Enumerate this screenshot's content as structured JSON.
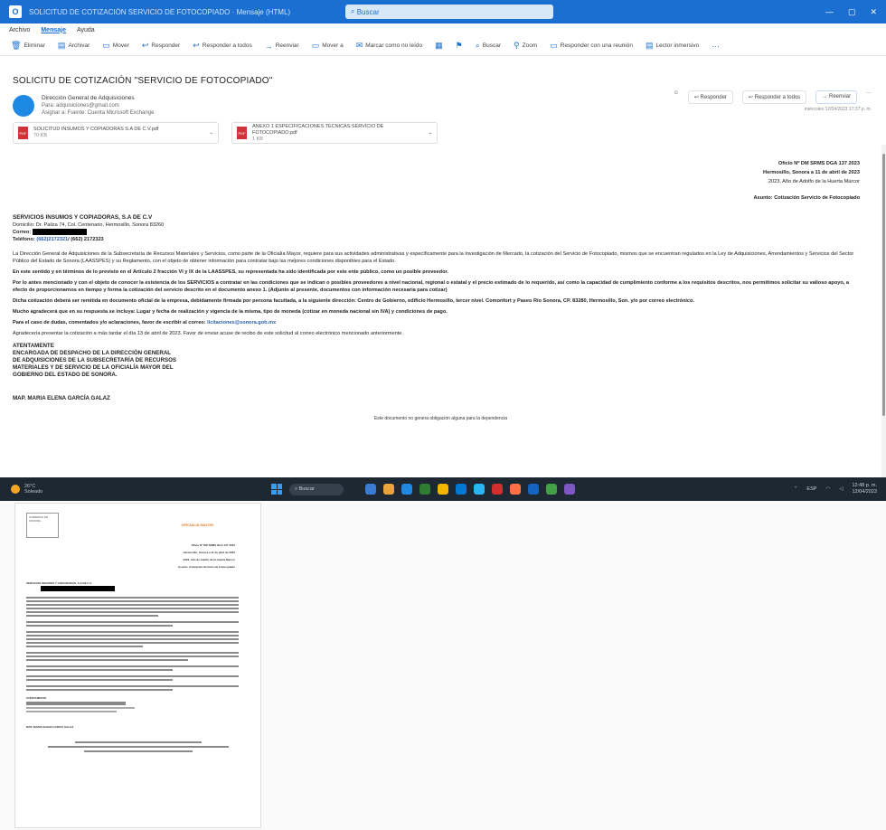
{
  "window": {
    "title": "SOLICITUD DE COTIZACIÓN SERVICIO DE FOTOCOPIADO · Mensaje (HTML)",
    "search_placeholder": "Buscar",
    "controls": [
      "—",
      "▢",
      "✕"
    ]
  },
  "menu_tabs": [
    "Archivo",
    "Mensaje",
    "Ayuda"
  ],
  "ribbon": [
    {
      "icon": "delete-icon",
      "glyph": "🗑",
      "label": "Eliminar"
    },
    {
      "icon": "archive-icon",
      "glyph": "▤",
      "label": "Archivar"
    },
    {
      "icon": "move-icon",
      "glyph": "▭",
      "label": "Mover"
    },
    {
      "icon": "reply-icon",
      "glyph": "↩",
      "label": "Responder"
    },
    {
      "icon": "reply-all-icon",
      "glyph": "↩",
      "label": "Responder a todos"
    },
    {
      "icon": "forward-icon",
      "glyph": "→",
      "label": "Reenviar"
    },
    {
      "icon": "quick-steps-icon",
      "glyph": "▭",
      "label": "Mover a"
    },
    {
      "icon": "mark-read-icon",
      "glyph": "✉",
      "label": "Marcar como no leído"
    },
    {
      "icon": "categorize-icon",
      "glyph": "▦",
      "label": ""
    },
    {
      "icon": "flag-icon",
      "glyph": "⚑",
      "label": ""
    },
    {
      "icon": "find-icon",
      "glyph": "⌕",
      "label": "Buscar"
    },
    {
      "icon": "zoom-icon",
      "glyph": "⚲",
      "label": "Zoom"
    },
    {
      "icon": "reply-all-meeting-icon",
      "glyph": "▭",
      "label": "Responder con una reunión"
    },
    {
      "icon": "immersive-reader-icon",
      "glyph": "▤",
      "label": "Lector inmersivo"
    },
    {
      "icon": "more-icon",
      "glyph": "···",
      "label": ""
    }
  ],
  "message": {
    "subject": "SOLICITU DE COTIZACIÓN \"SERVICIO DE FOTOCOPIADO\"",
    "sender_name": "Dirección General de Adquisiciones",
    "sender_email": "Para: adquisiciones@gmail.com",
    "sender_extra": "Asignar a: Fuente: Cuenta Microsoft Exchange",
    "actions": [
      "Responder",
      "Responder a todos",
      "Reenviar"
    ],
    "date": "miércoles 12/04/2023 17:37 p. m.",
    "attachments": [
      {
        "name": "SOLICITUD INSUMOS Y COPIADORAS S.A DE C.V.pdf",
        "size": "70 KB"
      },
      {
        "name": "ANEXO 1 ESPECIFICACIONES TECNICAS SERVICIO DE FOTOCOPIADO.pdf",
        "size": "1 KB"
      }
    ]
  },
  "letter": {
    "oficio": "Oficio Nº DM SRMS DGA 137 2023",
    "place_date": "Hermosillo, Sonora a 11 de abril de 2023",
    "year_motto": "2023, Año de Adolfo de la Huerta Marcor",
    "asunto": "Asunto: Cotización Servicio de Fotocopiado",
    "firm": "SERVICIOS INSUMOS Y COPIADORAS, S.A DE C.V",
    "address": "Domicilio: Dr. Paliza 74, Col. Centenario, Hermosillo, Sonora 83260",
    "email_label": "Correo:",
    "phone_label": "Teléfono:",
    "phone_value": "(662) 2172323",
    "paragraphs": [
      {
        "text": "La Dirección General de Adquisiciones de la Subsecretaría de Recursos Materiales y Servicios, como parte de la Oficialía Mayor, requiere para sus actividades administrativas y específicamente para la Investigación de Mercado, la cotización del Servicio de Fotocopiado, mismos que se encuentran regulados en la Ley de Adquisiciones, Arrendamientos y Servicios del Sector Público del Estado de Sonora (LAASSPES) y su Reglamento, con el objeto de obtener información para contratar bajo las mejores condiciones disponibles para el Estado.",
        "bold": false
      },
      {
        "text": "En este sentido y en términos de lo previsto en el Artículo 2 fracción VI y IX de la LAASSPES, su representada ha sido identificada por este ente público, como un posible proveedor.",
        "bold": true
      },
      {
        "text": "Por lo antes mencionado y con el objeto de conocer la existencia de los SERVICIOS a contratar en las condiciones que se indican o posibles proveedores a nivel nacional, regional o estatal y el precio estimado de lo requerido, así como la capacidad de cumplimiento conforme a los requisitos descritos, nos permitimos solicitar su valioso apoyo, a efecto de proporcionarnos en tiempo y forma la cotización del servicio descrito en el documento anexo 1. (Adjunto al presente, documentos con información necesaria para cotizar)",
        "bold": true
      },
      {
        "text": "Dicha cotización deberá ser remitida en documento oficial de la empresa, debidamente firmada por persona facultada, a la siguiente dirección: Centro de Gobierno, edificio Hermosillo, tercer nivel. Comonfort y Paseo Río Sonora, CP. 83280, Hermosillo, Son. y/o por correo electrónico.",
        "bold": true
      },
      {
        "text": "Mucho agradecerá que en su respuesta se incluya: Lugar y fecha de realización y vigencia de la misma, tipo de moneda (cotizar en moneda nacional sin IVA) y condiciones de pago.",
        "bold": true
      },
      {
        "text": "Para el caso de dudas, comentados y/o aclaraciones, favor de escribir al correo:",
        "bold": true,
        "link": "licitaciones@sonora.gob.mx"
      },
      {
        "text": "Agradecería presentar la cotización a más tardar el día 13 de abril de 2023. Favor de enviar acuse de recibo de este solicitud al correo electrónico mencionado anteriormente.",
        "bold": false
      }
    ],
    "closing": "ATENTAMENTE",
    "signature_lines": [
      "ENCARGADA DE DESPACHO DE LA DIRECCIÓN GENERAL",
      "DE ADQUISICIONES DE LA SUBSECRETARÍA DE RECURSOS",
      "MATERIALES Y DE SERVICIO DE LA OFICIALÍA MAYOR DEL",
      "GOBIERNO DEL ESTADO DE SONORA."
    ],
    "signer": "MAP. MARIA ELENA GARCÍA GALAZ",
    "footer_note": "Este documento no genera obligación alguna para la dependencia"
  },
  "taskbar": {
    "weather_temp": "26°C",
    "weather_desc": "Soleado",
    "search_label": "Buscar",
    "app_colors": [
      "#3a7bd5",
      "#e8a33a",
      "#1e88e5",
      "#2e7d32",
      "#f4b400",
      "#0078d4",
      "#29b6f6",
      "#d32f2f",
      "#ff7043",
      "#1565c0",
      "#43a047",
      "#7e57c2"
    ],
    "tray_lang": "ESP",
    "clock_time": "12:48 p. m.",
    "clock_date": "12/04/2023"
  },
  "scan": {
    "seal_text": "GOBIERNO DE SONORA",
    "logo_right": "OFICIALÍA MAYOR",
    "right_lines": [
      "Oficio Nº DM SRMS DGA 137 2023",
      "Hermosillo, Sonora a 11 de abril de 2023",
      "2023, Año de Adolfo de la Huerta Marcor",
      "Asunto: Cotización Servicio de Fotocopiado"
    ],
    "firm": "SERVICIOS INSUMOS Y COPIADORAS, S.A DE C.V",
    "closing": "ATENTAMENTE",
    "signer": "MAP. MARIA ELENA GARCÍA GALAZ"
  }
}
